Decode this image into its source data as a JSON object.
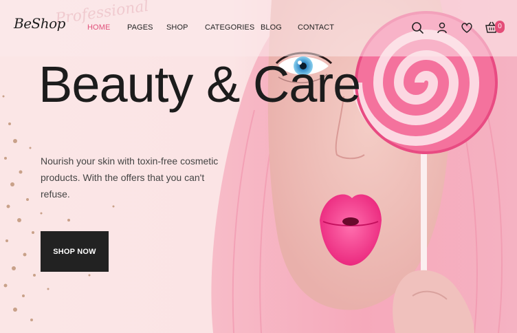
{
  "header": {
    "logo_text": "BeShop",
    "logo_watermark": "Professional",
    "nav": [
      {
        "label": "HOME",
        "active": true
      },
      {
        "label": "PAGES",
        "active": false
      },
      {
        "label": "SHOP",
        "active": false
      },
      {
        "label": "CATEGORIES",
        "active": false
      },
      {
        "label": "BLOG",
        "active": false
      },
      {
        "label": "CONTACT",
        "active": false
      }
    ],
    "icons": [
      "search-icon",
      "user-icon",
      "heart-icon",
      "cart-icon"
    ],
    "cart_count": "0"
  },
  "hero": {
    "title": "Beauty & Care",
    "subtitle": "Nourish your skin with toxin-free cosmetic products. With the offers that you can't refuse.",
    "cta_label": "SHOP NOW"
  },
  "colors": {
    "accent": "#e44d78",
    "background": "#fbe5e6",
    "button": "#222222"
  }
}
